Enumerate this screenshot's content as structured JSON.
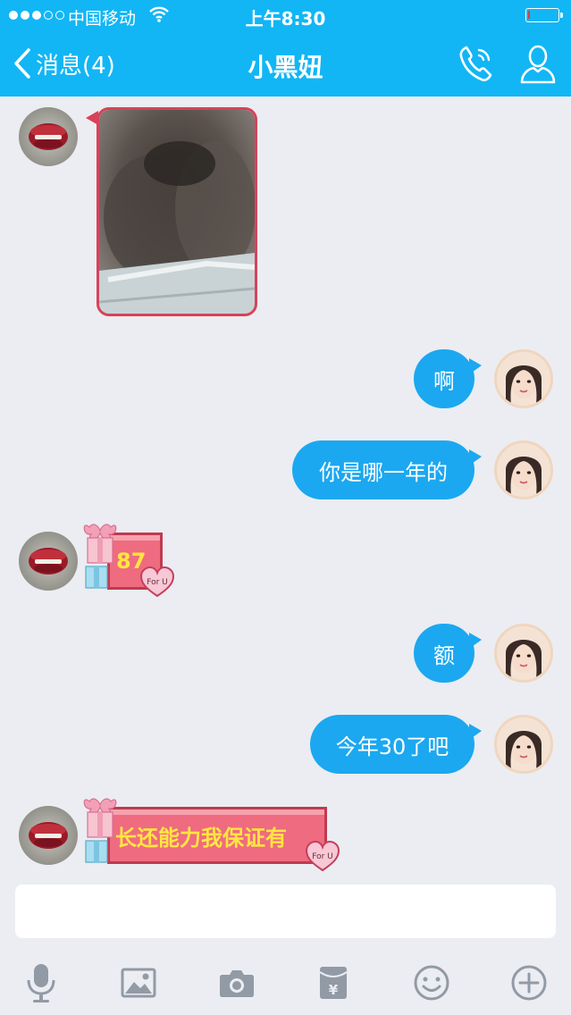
{
  "status_bar": {
    "carrier": "中国移动",
    "time": "上午8:30",
    "signal_bars_filled": 3,
    "signal_bars_total": 5,
    "battery_level": 0.05,
    "battery_color": "#e53935"
  },
  "header": {
    "back_label": "消息(4)",
    "title": "小黑妞",
    "phone_icon": "phone-icon",
    "profile_icon": "profile-icon",
    "background": "#12b6f5"
  },
  "messages": [
    {
      "from": "contact",
      "type": "image",
      "content": "photo"
    },
    {
      "from": "me",
      "type": "text",
      "text": "啊"
    },
    {
      "from": "me",
      "type": "text",
      "text": "你是哪一年的"
    },
    {
      "from": "contact",
      "type": "gift",
      "text": "87",
      "tag": "For U"
    },
    {
      "from": "me",
      "type": "text",
      "text": "额"
    },
    {
      "from": "me",
      "type": "text",
      "text": "今年30了吧"
    },
    {
      "from": "contact",
      "type": "gift",
      "text": "长还能力我保证有",
      "tag": "For U"
    }
  ],
  "colors": {
    "my_bubble": "#1ba8f0",
    "gift_card": "#ef6b80",
    "gift_text": "#ffe640",
    "chat_background": "#ebedf2"
  },
  "input": {
    "value": "",
    "placeholder": ""
  },
  "toolbar": [
    {
      "icon": "microphone-icon"
    },
    {
      "icon": "image-icon"
    },
    {
      "icon": "camera-icon"
    },
    {
      "icon": "red-packet-icon"
    },
    {
      "icon": "emoji-icon"
    },
    {
      "icon": "plus-icon"
    }
  ]
}
